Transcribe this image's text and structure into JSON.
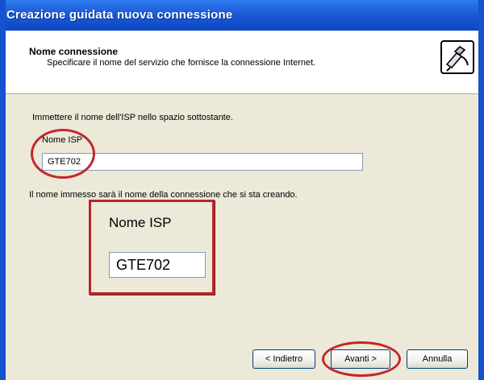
{
  "window": {
    "title": "Creazione guidata nuova connessione"
  },
  "header": {
    "title": "Nome connessione",
    "subtitle": "Specificare il nome del servizio che fornisce la connessione Internet.",
    "icon": "wizard-connection-icon"
  },
  "form": {
    "instruction": "Immettere il nome dell'ISP nello spazio sottostante.",
    "isp_label": "Nome ISP",
    "isp_value": "GTE702",
    "hint": "Il nome immesso sarà il nome della connessione che si sta creando."
  },
  "zoom": {
    "label": "Nome ISP",
    "value": "GTE702"
  },
  "buttons": {
    "back": "< Indietro",
    "next": "Avanti >",
    "cancel": "Annulla"
  },
  "colors": {
    "title_bar": "#1a5ad6",
    "highlight": "#c1272d",
    "dialog_bg": "#ece9d8"
  }
}
